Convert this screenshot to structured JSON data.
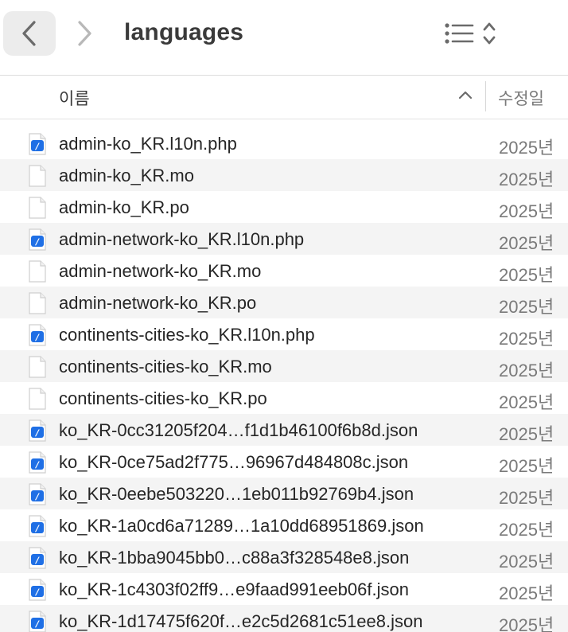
{
  "window": {
    "title": "languages"
  },
  "toolbar": {
    "back_icon": "chevron-left-icon",
    "forward_icon": "chevron-right-icon",
    "view_icon": "list-view-icon",
    "view_menu_icon": "up-down-chevron-icon"
  },
  "columns": {
    "name": "이름",
    "date_modified": "수정일",
    "sort_direction": "ascending"
  },
  "files": [
    {
      "name": "admin-ko_KR.l10n.php",
      "date": "2025년",
      "type": "php"
    },
    {
      "name": "admin-ko_KR.mo",
      "date": "2025년",
      "type": "generic"
    },
    {
      "name": "admin-ko_KR.po",
      "date": "2025년",
      "type": "generic"
    },
    {
      "name": "admin-network-ko_KR.l10n.php",
      "date": "2025년",
      "type": "php"
    },
    {
      "name": "admin-network-ko_KR.mo",
      "date": "2025년",
      "type": "generic"
    },
    {
      "name": "admin-network-ko_KR.po",
      "date": "2025년",
      "type": "generic"
    },
    {
      "name": "continents-cities-ko_KR.l10n.php",
      "date": "2025년",
      "type": "php"
    },
    {
      "name": "continents-cities-ko_KR.mo",
      "date": "2025년",
      "type": "generic"
    },
    {
      "name": "continents-cities-ko_KR.po",
      "date": "2025년",
      "type": "generic"
    },
    {
      "name": "ko_KR-0cc31205f204…f1d1b46100f6b8d.json",
      "date": "2025년",
      "type": "json"
    },
    {
      "name": "ko_KR-0ce75ad2f775…96967d484808c.json",
      "date": "2025년",
      "type": "json"
    },
    {
      "name": "ko_KR-0eebe503220…1eb011b92769b4.json",
      "date": "2025년",
      "type": "json"
    },
    {
      "name": "ko_KR-1a0cd6a71289…1a10dd68951869.json",
      "date": "2025년",
      "type": "json"
    },
    {
      "name": "ko_KR-1bba9045bb0…c88a3f328548e8.json",
      "date": "2025년",
      "type": "json"
    },
    {
      "name": "ko_KR-1c4303f02ff9…e9faad991eeb06f.json",
      "date": "2025년",
      "type": "json"
    },
    {
      "name": "ko_KR-1d17475f620f…e2c5d2681c51ee8.json",
      "date": "2025년",
      "type": "json"
    }
  ],
  "colors": {
    "accent_icon": "#1f6fe5",
    "row_alt": "#f4f4f4",
    "secondary_text": "#7a7a7a"
  }
}
